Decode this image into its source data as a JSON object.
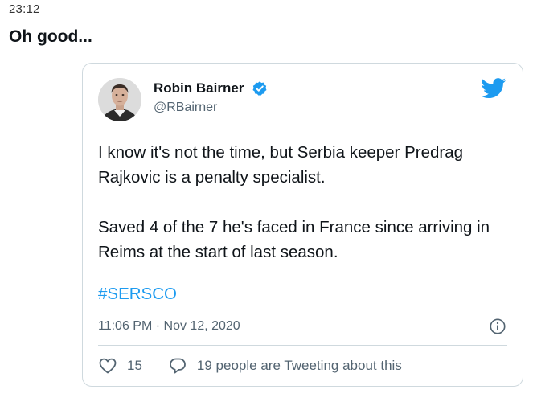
{
  "message": {
    "timestamp": "23:12",
    "text": "Oh good..."
  },
  "tweet": {
    "author_name": "Robin Bairner",
    "author_handle": "@RBairner",
    "verified": true,
    "paragraphs": [
      "I know it's not the time, but Serbia keeper Predrag Rajkovic is a penalty specialist.",
      "Saved 4 of the 7 he's faced in France since arriving in Reims at the start of last season."
    ],
    "hashtag": "#SERSCO",
    "datetime": "11:06 PM · Nov 12, 2020",
    "like_count": "15",
    "reply_text": "19 people are Tweeting about this"
  },
  "colors": {
    "brand_blue": "#1d9bf0",
    "text_primary": "#0f1419",
    "text_secondary": "#536471",
    "border": "#cfd9de"
  },
  "icons": [
    "verified-badge-icon",
    "twitter-bird-icon",
    "info-icon",
    "heart-icon",
    "reply-bubble-icon"
  ]
}
